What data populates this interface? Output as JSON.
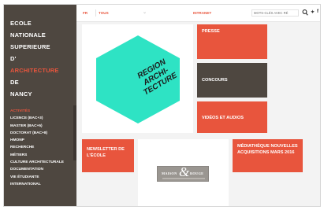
{
  "sidebar": {
    "school_lines": [
      {
        "text": "ECOLE",
        "accent": false
      },
      {
        "text": "NATIONALE",
        "accent": false
      },
      {
        "text": "SUPERIEURE",
        "accent": false
      },
      {
        "text": "D'",
        "accent": false
      },
      {
        "text": "ARCHITECTURE",
        "accent": true
      },
      {
        "text": "DE",
        "accent": false
      },
      {
        "text": "NANCY",
        "accent": false
      }
    ],
    "section_heading": "ACTIVITÉS",
    "items": [
      "LICENCE (BAC+3)",
      "MASTER (BAC+5)",
      "DOCTORAT (BAC+8)",
      "HMONP",
      "RECHERCHE",
      "MÉTIERS",
      "CULTURE ARCHITECTURALE",
      "DOCUMENTATION",
      "VIE ÉTUDIANTE",
      "INTERNATIONAL"
    ]
  },
  "topbar": {
    "lang": "FR",
    "filter": "TOUS",
    "intranet": "INTRANET",
    "search_placeholder": "MOTS-CLÉS AVEC RÉ"
  },
  "tiles": {
    "hero_text": "REGION ARCHI-TECTURE",
    "presse": "PRESSE",
    "concours": "CONCOURS",
    "videos": "VIDÉOS ET AUDIOS",
    "newsletter": "NEWSLETTER DE L'ÉCOLE",
    "mediatheque": "MÉDIATHÈQUE NOUVELLES ACQUISITIONS MARS 2016",
    "logo_left": "MAISON",
    "logo_right": "ROUGE"
  },
  "colors": {
    "accent": "#e8553d",
    "sidebar": "#4e4740",
    "hex": "#2ee3c4"
  }
}
